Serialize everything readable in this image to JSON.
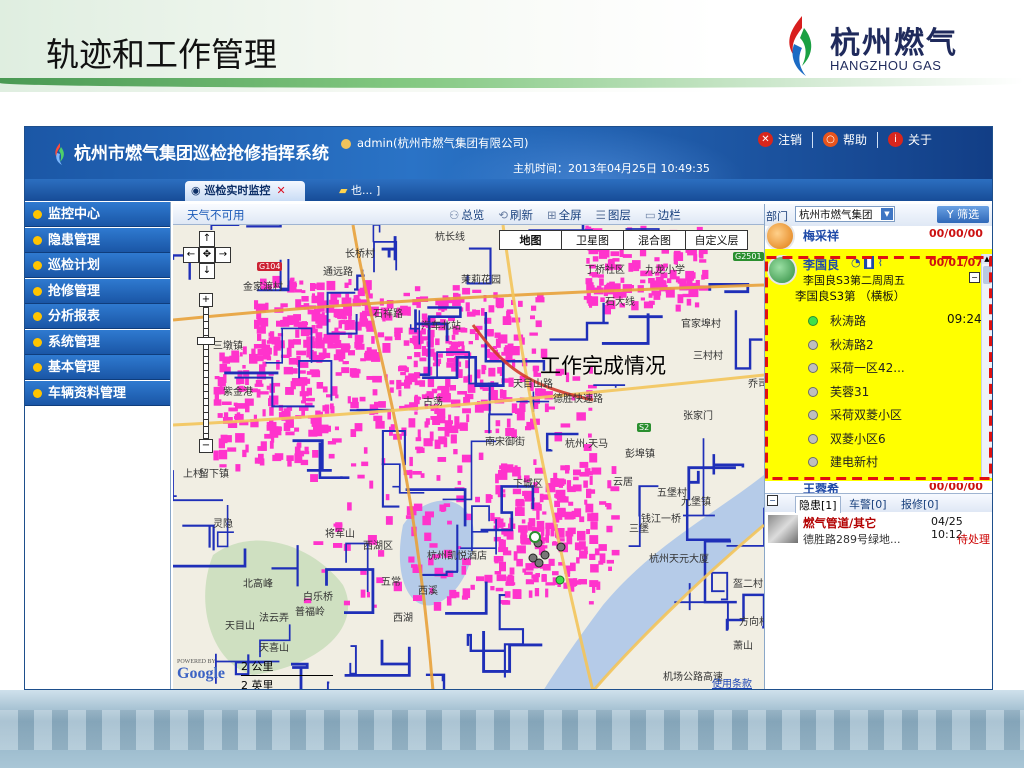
{
  "slide": {
    "title": "轨迹和工作管理",
    "logo_cn": "杭州燃气",
    "logo_en": "HANGZHOU GAS"
  },
  "app": {
    "title": "杭州市燃气集团巡检抢修指挥系统",
    "user": "admin(杭州市燃气集团有限公司)",
    "server_time": "主机时间：2013年04月25日 10:49:35",
    "links": [
      {
        "label": "注销",
        "icon": "close-icon",
        "color": "#d9261c"
      },
      {
        "label": "帮助",
        "icon": "lifebuoy-icon",
        "color": "#e8541c"
      },
      {
        "label": "关于",
        "icon": "info-icon",
        "color": "#d9261c"
      }
    ],
    "active_tab": "巡检实时监控",
    "tab_message": "也... ]"
  },
  "nav": {
    "items": [
      "监控中心",
      "隐患管理",
      "巡检计划",
      "抢修管理",
      "分析报表",
      "系统管理",
      "基本管理",
      "车辆资料管理"
    ]
  },
  "toolbar": {
    "weather": "天气不可用",
    "buttons": [
      "总览",
      "刷新",
      "全屏",
      "图层",
      "边栏"
    ]
  },
  "map": {
    "types": [
      "地图",
      "卫星图",
      "混合图",
      "自定义层"
    ],
    "active_type": "地图",
    "annotation": "工作完成情况",
    "scale_km": "2 公里",
    "scale_mi": "2 英里",
    "google": "Google",
    "powered_by": "POWERED BY",
    "terms": "使用条款",
    "labels": [
      "杭长线",
      "长桥村",
      "通远路",
      "金家渡村",
      "茉莉花园",
      "丁桥社区",
      "九龙小学",
      "三墩镇",
      "石祥路",
      "石大线",
      "官家埠村",
      "汽车北站",
      "三村村",
      "紫金港",
      "古荡",
      "留下镇",
      "西溪",
      "五常",
      "北高峰",
      "白乐桥",
      "普福岭",
      "西湖",
      "将军山",
      "天目山",
      "法云弄",
      "上村",
      "天目山路",
      "彭埠镇",
      "杭州天元大厦",
      "五堡村",
      "三堡",
      "钱江一桥",
      "九堡镇",
      "盔二村",
      "方向村",
      "萧山",
      "天喜山",
      "机场公路高速",
      "杭州·天马",
      "杭州凯悦酒店",
      "灵隐",
      "张家门",
      "南宋御街",
      "德胜快速路",
      "下城区",
      "云居",
      "西湖区",
      "乔司"
    ],
    "shields": [
      "G104",
      "G2501",
      "S2"
    ]
  },
  "right_panel": {
    "dept_label": "部门",
    "dept_value": "杭州市燃气集团",
    "filter_label": "筛选",
    "persons": [
      {
        "name": "梅采祥",
        "date": "00/00/00"
      },
      {
        "name": "李国良",
        "date": "00/01/07"
      },
      {
        "name": "王蓉希",
        "date": "00/00/00"
      }
    ],
    "plan_line1": "李国良S3第二周周五",
    "plan_line2": "李国良S3第 （横板）",
    "routes": [
      {
        "name": "秋涛路",
        "time": "09:24",
        "done": true
      },
      {
        "name": "秋涛路2",
        "time": "",
        "done": false
      },
      {
        "name": "采荷一区42...",
        "time": "",
        "done": false
      },
      {
        "name": "芙蓉31",
        "time": "",
        "done": false
      },
      {
        "name": "采荷双菱小区",
        "time": "",
        "done": false
      },
      {
        "name": "双菱小区6",
        "time": "",
        "done": false
      },
      {
        "name": "建电新村",
        "time": "",
        "done": false
      }
    ],
    "lower_tabs": [
      "隐患[1]",
      "车警[0]",
      "报修[0]"
    ],
    "alert": {
      "title": "燃气管道/其它",
      "time": "04/25 10:12",
      "address": "德胜路289号绿地...",
      "status": "待处理"
    }
  },
  "colors": {
    "header_blue": "#1b57a6",
    "pipeline_magenta": "#ff33cc",
    "pipeline_blue": "#1f2fb8",
    "highlight_yellow": "#ffff00",
    "dash_red": "#e01010"
  }
}
